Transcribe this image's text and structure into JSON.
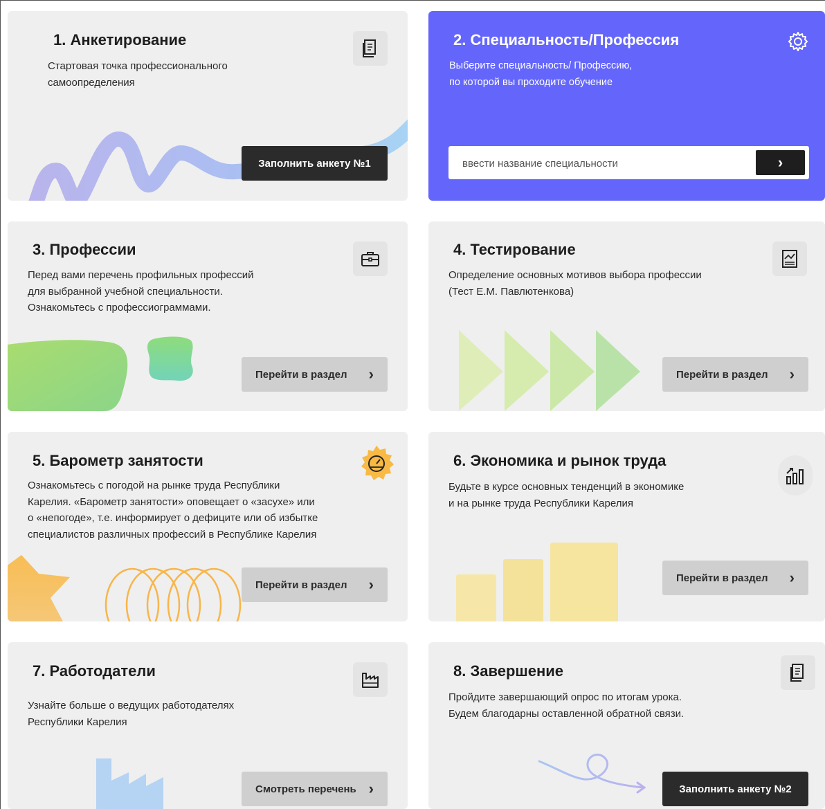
{
  "cards": [
    {
      "title": "1. Анкетирование",
      "desc": [
        "Стартовая точка профессионального",
        "самоопределения"
      ],
      "button": "Заполнить анкету №1",
      "icon": "document-icon"
    },
    {
      "title": "2. Специальность/Профессия",
      "desc": [
        "Выберите специальность/ Профессию,",
        "по которой вы проходите обучение"
      ],
      "input_placeholder": "ввести название специальности",
      "icon": "gear-icon"
    },
    {
      "title": "3. Профессии",
      "desc": [
        "Перед вами перечень профильных профессий",
        "для выбранной учебной специальности.",
        "Ознакомьтесь с профессиограммами."
      ],
      "button": "Перейти в раздел",
      "icon": "briefcase-icon"
    },
    {
      "title": "4. Тестирование",
      "desc": [
        "Определение основных мотивов выбора профессии",
        "(Тест Е.М. Павлютенкова)"
      ],
      "button": "Перейти в раздел",
      "icon": "chart-document-icon"
    },
    {
      "title": "5. Барометр занятости",
      "desc": [
        "Ознакомьтесь с погодой на рынке труда Республики",
        "Карелия. «Барометр занятости» оповещает о «засухе» или",
        "о «непогоде», т.е. информирует о дефиците или об избытке",
        "специалистов различных профессий в Республике Карелия"
      ],
      "button": "Перейти в раздел",
      "icon": "barometer-icon"
    },
    {
      "title": "6. Экономика и рынок труда",
      "desc": [
        "Будьте в курсе основных тенденций в экономике",
        "и на рынке труда Республики Карелия"
      ],
      "button": "Перейти в раздел",
      "icon": "growth-chart-icon"
    },
    {
      "title": "7. Работодатели",
      "desc": [
        "Узнайте больше о ведущих работодателях",
        "Республики Карелия"
      ],
      "button": "Смотреть перечень",
      "icon": "factory-icon"
    },
    {
      "title": "8. Завершение",
      "desc": [
        "Пройдите завершающий опрос по итогам урока.",
        "Будем благодарны оставленной обратной связи."
      ],
      "button": "Заполнить анкету №2",
      "icon": "document-icon"
    }
  ],
  "colors": {
    "accent": "#6466fb",
    "card_bg": "#efefef",
    "dark_button": "#2b2b2b",
    "gray_button": "#cfcfcf"
  }
}
